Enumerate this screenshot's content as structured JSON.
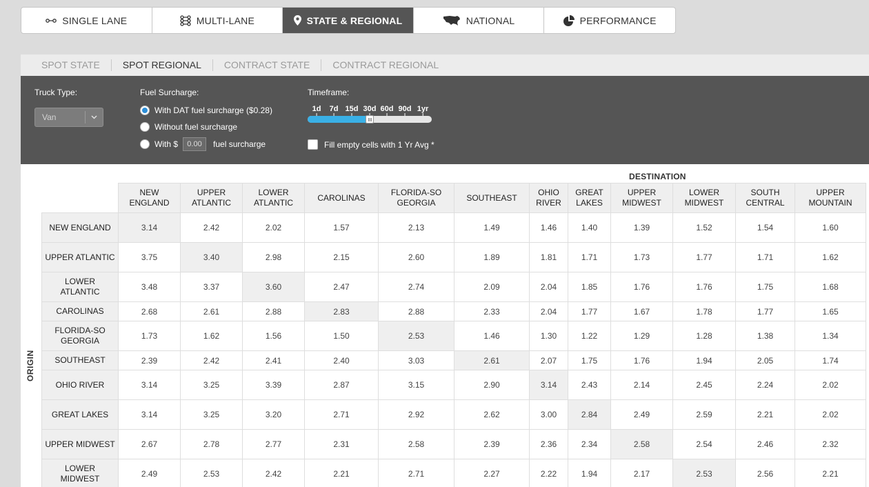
{
  "main_tabs": [
    {
      "label": "SINGLE LANE",
      "icon": "single-lane-icon"
    },
    {
      "label": "MULTI-LANE",
      "icon": "multi-lane-icon"
    },
    {
      "label": "STATE & REGIONAL",
      "icon": "map-pin-icon",
      "active": true
    },
    {
      "label": "NATIONAL",
      "icon": "usa-map-icon"
    },
    {
      "label": "PERFORMANCE",
      "icon": "pie-chart-icon"
    }
  ],
  "sub_tabs": [
    {
      "label": "SPOT STATE"
    },
    {
      "label": "SPOT REGIONAL",
      "active": true
    },
    {
      "label": "CONTRACT STATE"
    },
    {
      "label": "CONTRACT REGIONAL"
    }
  ],
  "filters": {
    "truck_type_label": "Truck Type:",
    "truck_type_value": "Van",
    "fuel_surcharge_label": "Fuel Surcharge:",
    "fuel_options": {
      "dat": "With DAT fuel surcharge ($0.28)",
      "none": "Without fuel surcharge",
      "custom_prefix": "With $",
      "custom_value": "0.00",
      "custom_suffix": "fuel surcharge"
    },
    "fuel_selected": "dat",
    "timeframe_label": "Timeframe:",
    "timeframe_ticks": [
      "1d",
      "7d",
      "15d",
      "30d",
      "60d",
      "90d",
      "1yr"
    ],
    "timeframe_selected": "30d",
    "fill_empty_label": "Fill empty cells with 1 Yr Avg *",
    "fill_empty_checked": false
  },
  "table": {
    "destination_label": "DESTINATION",
    "origin_label": "ORIGIN",
    "columns": [
      "NEW ENGLAND",
      "UPPER ATLANTIC",
      "LOWER ATLANTIC",
      "CAROLINAS",
      "FLORIDA-SO GEORGIA",
      "SOUTHEAST",
      "OHIO RIVER",
      "GREAT LAKES",
      "UPPER MIDWEST",
      "LOWER MIDWEST",
      "SOUTH CENTRAL",
      "UPPER MOUNTAIN"
    ],
    "rows": [
      {
        "label": "NEW ENGLAND",
        "values": [
          "3.14",
          "2.42",
          "2.02",
          "1.57",
          "2.13",
          "1.49",
          "1.46",
          "1.40",
          "1.39",
          "1.52",
          "1.54",
          "1.60"
        ]
      },
      {
        "label": "UPPER ATLANTIC",
        "values": [
          "3.75",
          "3.40",
          "2.98",
          "2.15",
          "2.60",
          "1.89",
          "1.81",
          "1.71",
          "1.73",
          "1.77",
          "1.71",
          "1.62"
        ]
      },
      {
        "label": "LOWER ATLANTIC",
        "values": [
          "3.48",
          "3.37",
          "3.60",
          "2.47",
          "2.74",
          "2.09",
          "2.04",
          "1.85",
          "1.76",
          "1.76",
          "1.75",
          "1.68"
        ]
      },
      {
        "label": "CAROLINAS",
        "values": [
          "2.68",
          "2.61",
          "2.88",
          "2.83",
          "2.88",
          "2.33",
          "2.04",
          "1.77",
          "1.67",
          "1.78",
          "1.77",
          "1.65"
        ]
      },
      {
        "label": "FLORIDA-SO GEORGIA",
        "values": [
          "1.73",
          "1.62",
          "1.56",
          "1.50",
          "2.53",
          "1.46",
          "1.30",
          "1.22",
          "1.29",
          "1.28",
          "1.38",
          "1.34"
        ]
      },
      {
        "label": "SOUTHEAST",
        "values": [
          "2.39",
          "2.42",
          "2.41",
          "2.40",
          "3.03",
          "2.61",
          "2.07",
          "1.75",
          "1.76",
          "1.94",
          "2.05",
          "1.74"
        ]
      },
      {
        "label": "OHIO RIVER",
        "values": [
          "3.14",
          "3.25",
          "3.39",
          "2.87",
          "3.15",
          "2.90",
          "3.14",
          "2.43",
          "2.14",
          "2.45",
          "2.24",
          "2.02"
        ]
      },
      {
        "label": "GREAT LAKES",
        "values": [
          "3.14",
          "3.25",
          "3.20",
          "2.71",
          "2.92",
          "2.62",
          "3.00",
          "2.84",
          "2.49",
          "2.59",
          "2.21",
          "2.02"
        ]
      },
      {
        "label": "UPPER MIDWEST",
        "values": [
          "2.67",
          "2.78",
          "2.77",
          "2.31",
          "2.58",
          "2.39",
          "2.36",
          "2.34",
          "2.58",
          "2.54",
          "2.46",
          "2.32"
        ]
      },
      {
        "label": "LOWER MIDWEST",
        "values": [
          "2.49",
          "2.53",
          "2.42",
          "2.21",
          "2.71",
          "2.27",
          "2.22",
          "1.94",
          "2.17",
          "2.53",
          "2.56",
          "2.21"
        ]
      }
    ]
  },
  "colors": {
    "active_tab_bg": "#555555",
    "filter_panel_bg": "#555555",
    "slider_fill": "#3ab0e6",
    "radio_selected": "#2d8fd8",
    "diagonal_cell_bg": "#efefef"
  }
}
